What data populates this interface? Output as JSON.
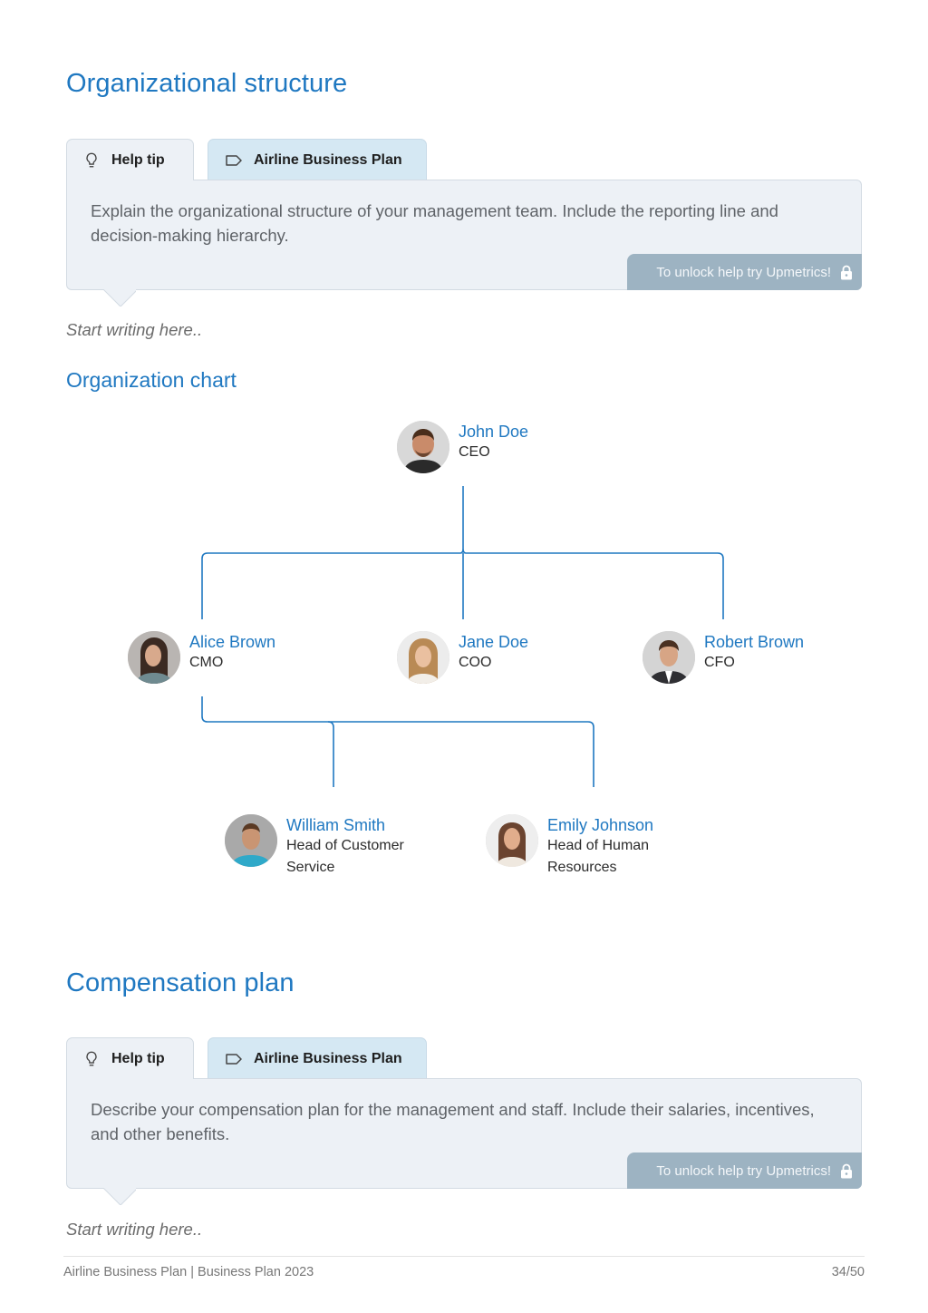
{
  "sections": {
    "org_structure": {
      "title": "Organizational structure",
      "help_tab": "Help tip",
      "plan_tab": "Airline Business Plan",
      "help_text": "Explain the organizational structure of your management team. Include the reporting line and decision-making hierarchy.",
      "unlock_label": "To unlock help try Upmetrics!",
      "placeholder": "Start writing here.."
    },
    "org_chart": {
      "title": "Organization chart",
      "colors": {
        "name": "#1f78c1",
        "line": "#1f78c1"
      },
      "people": [
        {
          "id": "john",
          "name": "John Doe",
          "role": "CEO",
          "reports_to": null
        },
        {
          "id": "alice",
          "name": "Alice Brown",
          "role": "CMO",
          "reports_to": "john"
        },
        {
          "id": "jane",
          "name": "Jane Doe",
          "role": "COO",
          "reports_to": "john"
        },
        {
          "id": "robert",
          "name": "Robert Brown",
          "role": "CFO",
          "reports_to": "john"
        },
        {
          "id": "william",
          "name": "William Smith",
          "role": "Head of Customer Service",
          "role_lines": [
            "Head of Customer",
            "Service"
          ],
          "reports_to": "alice"
        },
        {
          "id": "emily",
          "name": "Emily Johnson",
          "role": "Head of Human Resources",
          "role_lines": [
            "Head of Human",
            "Resources"
          ],
          "reports_to": "alice"
        }
      ]
    },
    "compensation": {
      "title": "Compensation plan",
      "help_tab": "Help tip",
      "plan_tab": "Airline Business Plan",
      "help_text": "Describe your compensation plan for the management and staff. Include their salaries, incentives, and other benefits.",
      "unlock_label": "To unlock help try Upmetrics!",
      "placeholder": "Start writing here.."
    }
  },
  "footer": {
    "left": "Airline Business Plan | Business Plan 2023",
    "page": "34/50"
  },
  "icons": {
    "help_tab": "lightbulb-icon",
    "plan_tab": "tag-icon",
    "unlock": "lock-icon"
  }
}
